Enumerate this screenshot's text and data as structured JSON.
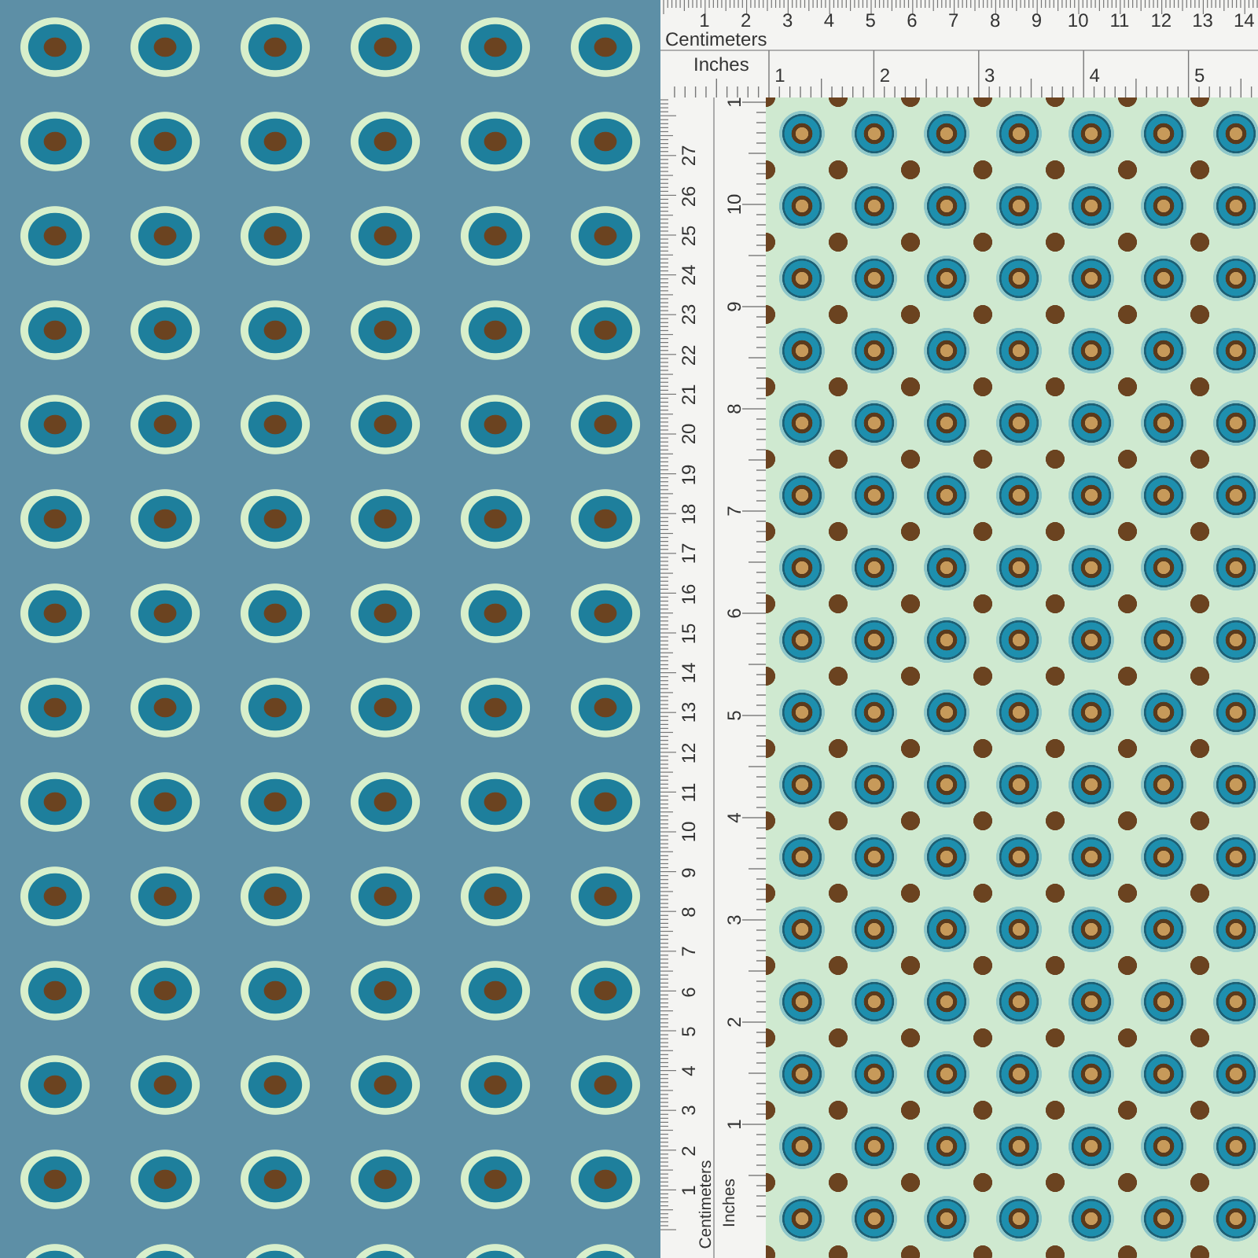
{
  "top_ruler": {
    "cm_numbers": [
      "1",
      "2",
      "3",
      "4",
      "5",
      "6",
      "7",
      "8",
      "9",
      "10",
      "11",
      "12",
      "13",
      "14"
    ],
    "cm_label": "Centimeters",
    "inch_label": "Inches",
    "inch_numbers": [
      "1",
      "2",
      "3",
      "4",
      "5"
    ]
  },
  "side_ruler": {
    "cm_numbers": [
      "1",
      "2",
      "3",
      "4",
      "5",
      "6",
      "7",
      "8",
      "9",
      "10",
      "11",
      "12",
      "13",
      "14",
      "15",
      "16",
      "17",
      "18",
      "19",
      "20",
      "21",
      "22",
      "23",
      "24",
      "25",
      "26",
      "27"
    ],
    "cm_label": "Centimeters",
    "inch_label": "Inches",
    "inch_numbers": [
      "1",
      "2",
      "3",
      "4",
      "5",
      "6",
      "7",
      "8",
      "9",
      "10",
      "1"
    ]
  }
}
